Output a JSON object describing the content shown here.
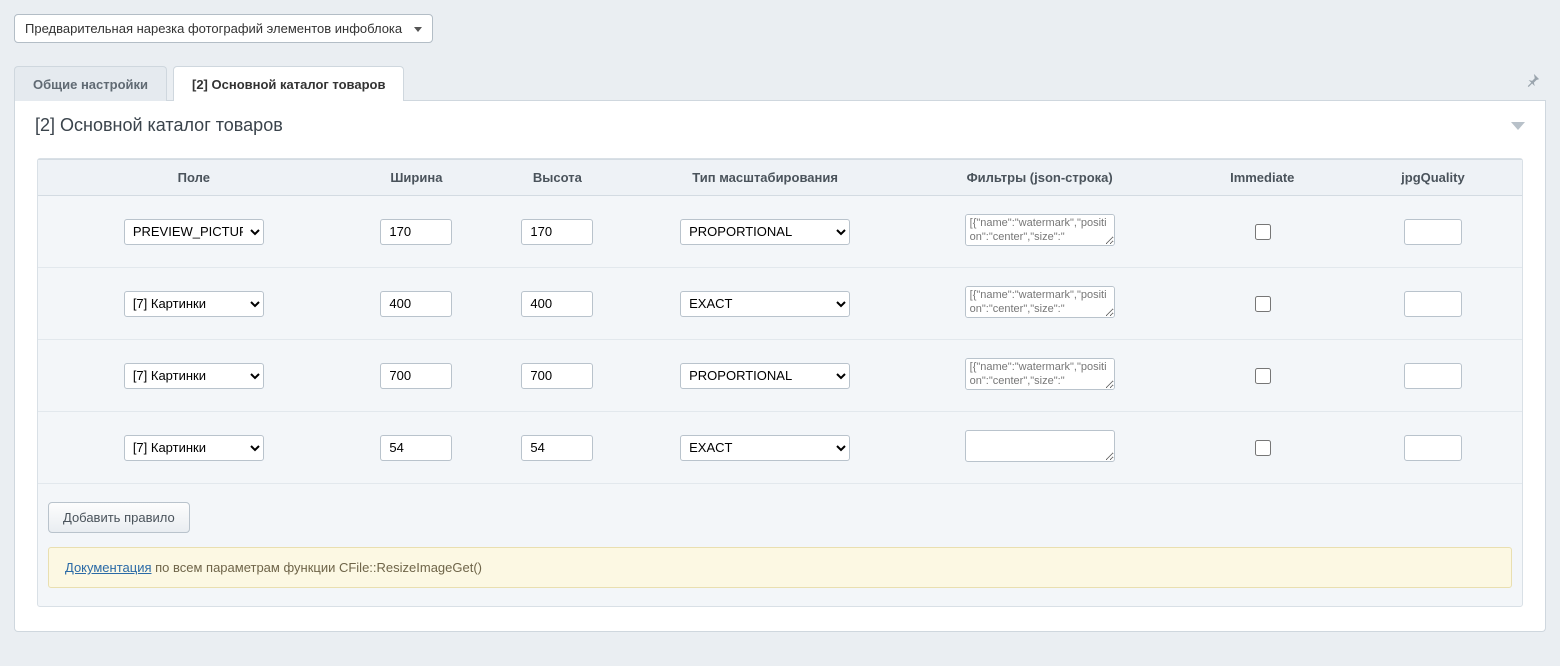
{
  "top_select": {
    "label": "Предварительная нарезка фотографий элементов инфоблока"
  },
  "tabs": [
    {
      "label": "Общие настройки",
      "active": false
    },
    {
      "label": "[2] Основной каталог товаров",
      "active": true
    }
  ],
  "panel": {
    "title": "[2] Основной каталог товаров"
  },
  "columns": {
    "field": "Поле",
    "width": "Ширина",
    "height": "Высота",
    "scaling": "Тип масштабирования",
    "filters": "Фильтры (json-строка)",
    "immediate": "Immediate",
    "jpg": "jpgQuality"
  },
  "field_options": [
    "PREVIEW_PICTURE",
    "[7] Картинки"
  ],
  "scale_options": [
    "PROPORTIONAL",
    "EXACT"
  ],
  "rows": [
    {
      "field": "PREVIEW_PICTURE",
      "width": "170",
      "height": "170",
      "scaling": "PROPORTIONAL",
      "filters": "[{\"name\":\"watermark\",\"position\":\"center\",\"size\":\"",
      "immediate": false,
      "jpg": ""
    },
    {
      "field": "[7] Картинки",
      "width": "400",
      "height": "400",
      "scaling": "EXACT",
      "filters": "[{\"name\":\"watermark\",\"position\":\"center\",\"size\":\"",
      "immediate": false,
      "jpg": ""
    },
    {
      "field": "[7] Картинки",
      "width": "700",
      "height": "700",
      "scaling": "PROPORTIONAL",
      "filters": "[{\"name\":\"watermark\",\"position\":\"center\",\"size\":\"",
      "immediate": false,
      "jpg": ""
    },
    {
      "field": "[7] Картинки",
      "width": "54",
      "height": "54",
      "scaling": "EXACT",
      "filters": "",
      "immediate": false,
      "jpg": ""
    }
  ],
  "add_button": "Добавить правило",
  "doc_note": {
    "link_text": "Документация",
    "rest": " по всем параметрам функции CFile::ResizeImageGet()"
  }
}
